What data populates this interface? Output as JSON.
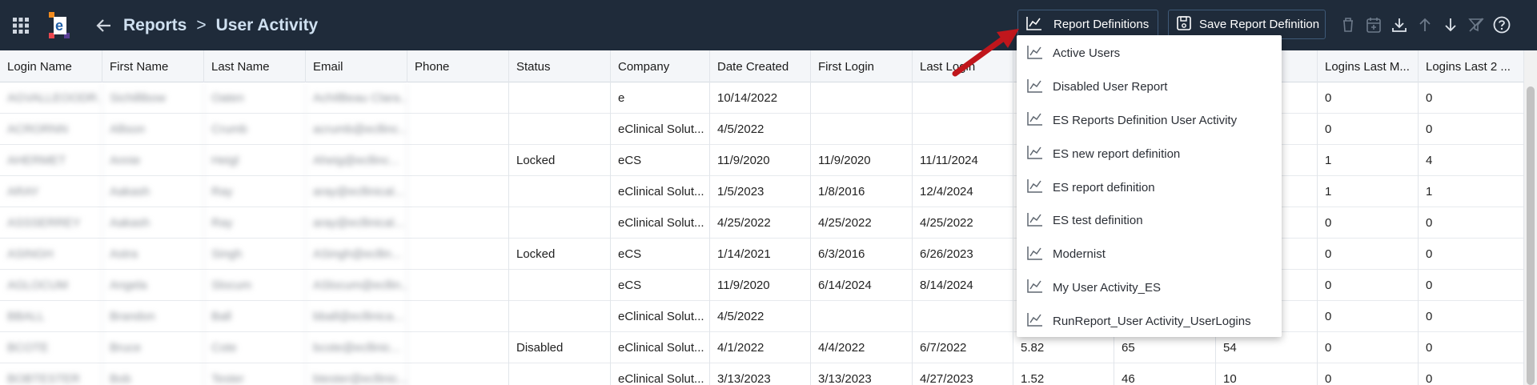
{
  "topbar": {
    "breadcrumb_root": "Reports",
    "breadcrumb_separator": ">",
    "breadcrumb_current": "User Activity",
    "report_definitions_label": "Report Definitions",
    "save_definition_label": "Save Report Definition"
  },
  "table": {
    "columns": [
      "Login Name",
      "First Name",
      "Last Name",
      "Email",
      "Phone",
      "Status",
      "Company",
      "Date Created",
      "First Login",
      "Last Login",
      "",
      "",
      "",
      "Logins Last M...",
      "Logins Last 2 ..."
    ],
    "rows": [
      [
        "AGVALLEOODR...",
        "Sichillibow",
        "Oaten",
        "AchIlBeau Clara...",
        "",
        "",
        "e",
        "10/14/2022",
        "",
        "",
        "",
        "",
        "",
        "0",
        "0"
      ],
      [
        "ACRORNN",
        "Allison",
        "Crumb",
        "acrumb@ecllinc...",
        "",
        "",
        "eClinical Solut...",
        "4/5/2022",
        "",
        "",
        "",
        "",
        "",
        "0",
        "0"
      ],
      [
        "AHERMET",
        "Annie",
        "Heigl",
        "Aheig@ecllinc...",
        "",
        "Locked",
        "eCS",
        "11/9/2020",
        "11/9/2020",
        "11/11/2024",
        "",
        "",
        "",
        "1",
        "4"
      ],
      [
        "ARAY",
        "Aakash",
        "Ray",
        "aray@ecllinical...",
        "",
        "",
        "eClinical Solut...",
        "1/5/2023",
        "1/8/2016",
        "12/4/2024",
        "",
        "",
        "",
        "1",
        "1"
      ],
      [
        "ASSSERREY",
        "Aakash",
        "Ray",
        "aray@ecllinical...",
        "",
        "",
        "eClinical Solut...",
        "4/25/2022",
        "4/25/2022",
        "4/25/2022",
        "",
        "",
        "",
        "0",
        "0"
      ],
      [
        "ASINGH",
        "Astra",
        "Singh",
        "ASingh@ecllin...",
        "",
        "Locked",
        "eCS",
        "1/14/2021",
        "6/3/2016",
        "6/26/2023",
        "",
        "",
        "",
        "0",
        "0"
      ],
      [
        "AGLOCUM",
        "Angela",
        "Slocum",
        "ASlocum@ecllin...",
        "",
        "",
        "eCS",
        "11/9/2020",
        "6/14/2024",
        "8/14/2024",
        "",
        "",
        "",
        "0",
        "0"
      ],
      [
        "BBALL",
        "Brandon",
        "Ball",
        "bball@ecllinica...",
        "",
        "",
        "eClinical Solut...",
        "4/5/2022",
        "",
        "",
        "",
        "",
        "",
        "0",
        "0"
      ],
      [
        "BCOTE",
        "Bruce",
        "Cote",
        "bcote@ecllinic...",
        "",
        "Disabled",
        "eClinical Solut...",
        "4/1/2022",
        "4/4/2022",
        "6/7/2022",
        "5.82",
        "65",
        "54",
        "0",
        "0"
      ],
      [
        "BOBTESTER",
        "Bob",
        "Tester",
        "btester@ecllinic...",
        "",
        "",
        "eClinical Solut...",
        "3/13/2023",
        "3/13/2023",
        "4/27/2023",
        "1.52",
        "46",
        "10",
        "0",
        "0"
      ]
    ]
  },
  "dropdown": {
    "items": [
      {
        "label": "Active Users"
      },
      {
        "label": "Disabled User Report"
      },
      {
        "label": "ES Reports Definition User Activity"
      },
      {
        "label": "ES new report definition"
      },
      {
        "label": "ES report definition"
      },
      {
        "label": "ES test definition"
      },
      {
        "label": "Modernist"
      },
      {
        "label": "My User Activity_ES"
      },
      {
        "label": "RunReport_User Activity_UserLogins"
      }
    ]
  },
  "colors": {
    "topbar_bg": "#1f2b3a",
    "accent_arrow": "#c0161c",
    "header_bg": "#f4f6f9"
  },
  "icons": [
    "apps-grid-icon",
    "app-logo",
    "back-arrow-icon",
    "chart-line-icon",
    "save-icon",
    "trash-icon",
    "calendar-add-icon",
    "download-icon",
    "arrow-up-icon",
    "arrow-down-icon",
    "filter-off-icon",
    "help-icon"
  ]
}
